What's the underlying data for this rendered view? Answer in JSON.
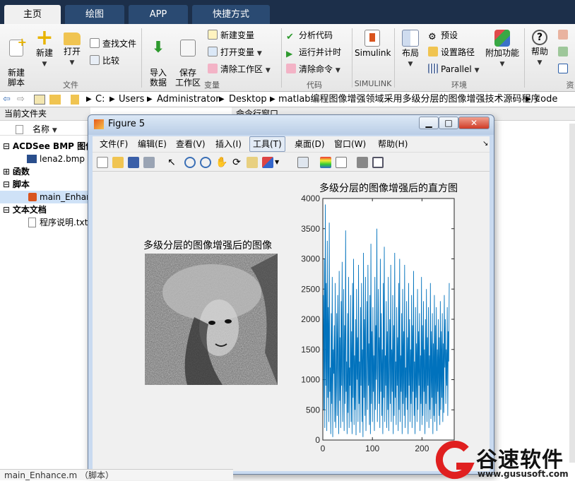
{
  "tabs": [
    {
      "label": "主页",
      "active": true
    },
    {
      "label": "绘图",
      "active": false
    },
    {
      "label": "APP",
      "active": false
    },
    {
      "label": "快捷方式",
      "active": false
    }
  ],
  "ribbon": {
    "file": {
      "new_script": "新建\n脚本",
      "new": "新建",
      "open": "打开",
      "find_files": "查找文件",
      "compare": "比较",
      "group": "文件"
    },
    "variable": {
      "import": "导入\n数据",
      "save": "保存\n工作区",
      "new_var": "新建变量",
      "open_var": "打开变量",
      "clear_ws": "清除工作区",
      "group": "变量"
    },
    "code": {
      "analyze": "分析代码",
      "run_timer": "运行并计时",
      "clear_cmd": "清除命令",
      "group": "代码"
    },
    "simulink": {
      "label": "Simulink",
      "group": "SIMULINK"
    },
    "env": {
      "layout": "布局",
      "prefs": "预设",
      "set_path": "设置路径",
      "parallel": "Parallel",
      "addons": "附加功能",
      "group": "环境"
    },
    "res": {
      "help": "帮助",
      "group": "资"
    }
  },
  "address": {
    "segments": [
      "C:",
      "Users",
      "Administrator",
      "Desktop",
      "matlab编程图像增强领域采用多级分层的图像增强技术源码程序",
      "code"
    ]
  },
  "left_panel": {
    "title": "当前文件夹",
    "column": "名称",
    "rows": [
      {
        "label": "ACDSee BMP 图像",
        "bold": true,
        "sign": "⊟"
      },
      {
        "label": "lena2.bmp",
        "bold": false,
        "sign": ""
      },
      {
        "label": "函数",
        "bold": true,
        "sign": "⊞"
      },
      {
        "label": "脚本",
        "bold": true,
        "sign": "⊟"
      },
      {
        "label": "main_Enhance.m",
        "bold": false,
        "sign": ""
      },
      {
        "label": "文本文档",
        "bold": true,
        "sign": "⊟"
      },
      {
        "label": "程序说明.txt",
        "bold": false,
        "sign": ""
      }
    ]
  },
  "command_window": {
    "title": "命令行窗口"
  },
  "figure": {
    "title": "Figure 5",
    "menus": [
      "文件(F)",
      "编辑(E)",
      "查看(V)",
      "插入(I)",
      "工具(T)",
      "桌面(D)",
      "窗口(W)",
      "帮助(H)"
    ],
    "active_menu": "工具(T)",
    "image_title": "多级分层的图像增强后的图像"
  },
  "status": {
    "text": "main_Enhance.m （脚本）"
  },
  "watermark": {
    "brand": "谷速软件",
    "url": "www.gususoft.com"
  },
  "colors": {
    "line": "#0072bd",
    "tabstrip": "#1c2f4a"
  },
  "chart_data": {
    "type": "line",
    "title": "多级分层的图像增强后的直方图",
    "xlabel": "",
    "ylabel": "",
    "xlim": [
      0,
      265
    ],
    "ylim": [
      0,
      4000
    ],
    "xticks": [
      0,
      100,
      200
    ],
    "yticks": [
      0,
      500,
      1000,
      1500,
      2000,
      2500,
      3000,
      3500,
      4000
    ],
    "grid": false,
    "series": [
      {
        "x_start": 1,
        "x_step": 1,
        "values": [
          2400,
          500,
          3000,
          200,
          3900,
          900,
          2600,
          150,
          3300,
          700,
          2200,
          300,
          3600,
          800,
          1200,
          100,
          2100,
          600,
          2700,
          50,
          1500,
          1100,
          1900,
          300,
          2600,
          200,
          900,
          2100,
          400,
          2400,
          1300,
          100,
          2800,
          650,
          1700,
          200,
          2300,
          900,
          2950,
          300,
          1100,
          2500,
          150,
          1900,
          600,
          3470,
          800,
          1300,
          100,
          2100,
          450,
          2700,
          200,
          1200,
          900,
          2400,
          300,
          1800,
          100,
          2600,
          700,
          3000,
          250,
          1400,
          500,
          2000,
          80,
          2500,
          1000,
          1700,
          300,
          2900,
          600,
          1300,
          120,
          2200,
          900,
          2600,
          300,
          1500,
          50,
          3100,
          700,
          2000,
          400,
          2700,
          150,
          1100,
          2300,
          500,
          2900,
          900,
          1600,
          250,
          2400,
          100,
          3250,
          600,
          1800,
          300,
          2200,
          800,
          1400,
          150,
          2700,
          500,
          1900,
          1000,
          3500,
          300,
          1200,
          2500,
          600,
          1700,
          200,
          3000,
          800,
          2100,
          400,
          1500,
          100,
          2600,
          700,
          3200,
          300,
          1400,
          900,
          2300,
          200,
          1800,
          500,
          2700,
          150,
          1100,
          2000,
          600,
          2900,
          300,
          1500,
          800,
          2400,
          100,
          1900,
          400,
          3100,
          700,
          1300,
          250,
          2200,
          900,
          1700,
          150,
          2600,
          500,
          3000,
          300,
          1400,
          800,
          2100,
          100,
          2500,
          600,
          1800,
          400,
          2900,
          200,
          1200,
          700,
          2300,
          500,
          1700,
          100,
          2600,
          900,
          2000,
          300,
          1500,
          600,
          2400,
          200,
          1900,
          800,
          2800,
          400,
          1300,
          100,
          2200,
          700,
          1600,
          300,
          2500,
          500,
          1800,
          900,
          2100,
          150,
          1400,
          600,
          2700,
          250,
          1900,
          400,
          2300,
          800,
          1500,
          100,
          2000,
          600,
          2500,
          300,
          1700,
          900,
          2200,
          200,
          1400,
          500,
          2600,
          350,
          1800,
          700,
          2100,
          100,
          1600,
          400,
          2400,
          300,
          1900,
          600,
          2200,
          150,
          1500,
          800,
          2000,
          400,
          1700,
          250,
          2300,
          500,
          1800,
          700,
          2100,
          300,
          1600,
          450,
          2400,
          1200,
          2000,
          600,
          1500,
          900,
          2200,
          400,
          1800,
          1300,
          2600
        ]
      }
    ]
  }
}
